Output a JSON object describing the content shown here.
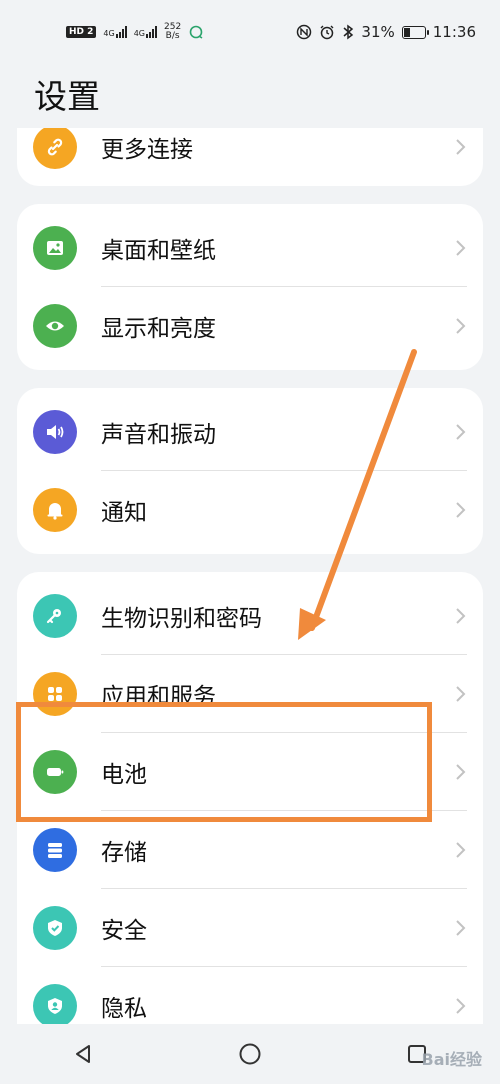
{
  "status_bar": {
    "hd": "HD 2",
    "net1": "4G",
    "net2": "4G",
    "speed_value": "252",
    "speed_unit": "B/s",
    "battery": "31%",
    "battery_level": 0.31,
    "time": "11:36"
  },
  "page_title": "设置",
  "groups": [
    {
      "items": [
        {
          "label": "更多连接",
          "icon": "link-icon",
          "color": "#f5a623"
        }
      ]
    },
    {
      "items": [
        {
          "label": "桌面和壁纸",
          "icon": "image-icon",
          "color": "#4cb050"
        },
        {
          "label": "显示和亮度",
          "icon": "eye-icon",
          "color": "#4cb050"
        }
      ]
    },
    {
      "items": [
        {
          "label": "声音和振动",
          "icon": "speaker-icon",
          "color": "#5b5bd6"
        },
        {
          "label": "通知",
          "icon": "bell-icon",
          "color": "#f5a623"
        }
      ]
    },
    {
      "items": [
        {
          "label": "生物识别和密码",
          "icon": "key-icon",
          "color": "#3cc6b4"
        },
        {
          "label": "应用和服务",
          "icon": "apps-icon",
          "color": "#f5a623"
        },
        {
          "label": "电池",
          "icon": "battery-icon",
          "color": "#4cb050"
        },
        {
          "label": "存储",
          "icon": "storage-icon",
          "color": "#2f6de1"
        },
        {
          "label": "安全",
          "icon": "shield-icon",
          "color": "#3cc6b4"
        },
        {
          "label": "隐私",
          "icon": "privacy-icon",
          "color": "#3cc6b4"
        }
      ]
    }
  ],
  "annotation": {
    "color": "#f08a3c"
  },
  "watermark": "Bai经验"
}
